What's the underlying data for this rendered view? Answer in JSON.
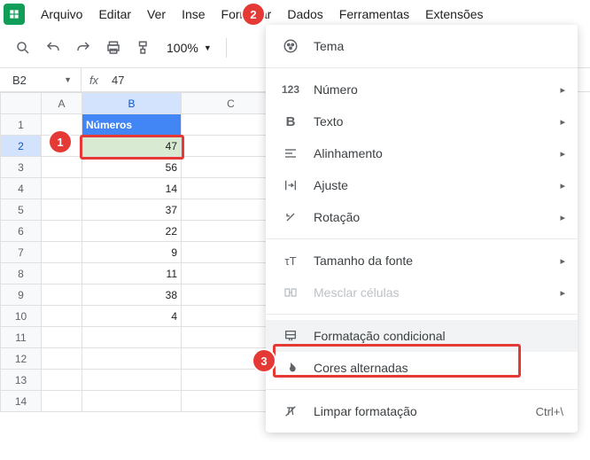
{
  "menubar": {
    "items": [
      "Arquivo",
      "Editar",
      "Ver",
      "Inse",
      "Formatar",
      "Dados",
      "Ferramentas",
      "Extensões"
    ]
  },
  "toolbar": {
    "zoom": "100%"
  },
  "fxbar": {
    "namebox": "B2",
    "fx_label": "fx",
    "value": "47"
  },
  "grid": {
    "columns": [
      "A",
      "B",
      "C"
    ],
    "header_label": "Números",
    "rows": [
      {
        "n": 1
      },
      {
        "n": 2,
        "b": "47"
      },
      {
        "n": 3,
        "b": "56"
      },
      {
        "n": 4,
        "b": "14"
      },
      {
        "n": 5,
        "b": "37"
      },
      {
        "n": 6,
        "b": "22"
      },
      {
        "n": 7,
        "b": "9"
      },
      {
        "n": 8,
        "b": "11"
      },
      {
        "n": 9,
        "b": "38"
      },
      {
        "n": 10,
        "b": "4"
      },
      {
        "n": 11
      },
      {
        "n": 12
      },
      {
        "n": 13
      },
      {
        "n": 14
      }
    ]
  },
  "dropdown": {
    "theme": "Tema",
    "number": "Número",
    "text": "Texto",
    "alignment": "Alinhamento",
    "wrap": "Ajuste",
    "rotation": "Rotação",
    "fontsize": "Tamanho da fonte",
    "merge": "Mesclar células",
    "condformat": "Formatação condicional",
    "altcolors": "Cores alternadas",
    "clear": "Limpar formatação",
    "clear_shortcut": "Ctrl+\\"
  },
  "badges": {
    "b1": "1",
    "b2": "2",
    "b3": "3"
  }
}
